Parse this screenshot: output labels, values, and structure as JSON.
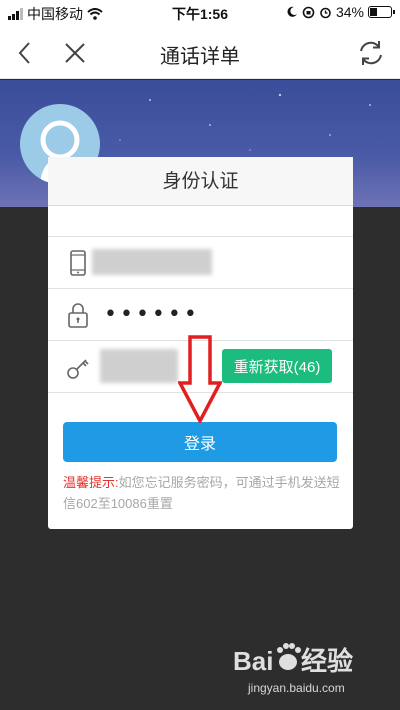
{
  "status_bar": {
    "carrier": "中国移动",
    "time": "下午1:56",
    "battery_percent": "34%",
    "battery_level": 0.34
  },
  "nav": {
    "title": "通话详单"
  },
  "card": {
    "title": "身份认证",
    "password_mask": "••••••",
    "resend_label": "重新获取(46)",
    "login_label": "登录",
    "tip_label": "温馨提示:",
    "tip_text": "如您忘记服务密码，可通过手机发送短信602至10086重置"
  },
  "watermark": {
    "brand": "Baidu经验",
    "url": "jingyan.baidu.com"
  },
  "colors": {
    "header_blue": "#3a4d9a",
    "resend_green": "#1bbc7d",
    "login_blue": "#1e9be4",
    "tip_red": "#e7322f",
    "annotation_red": "#e02020"
  },
  "icons": {
    "back": "chevron-left-icon",
    "close": "close-icon",
    "refresh": "refresh-icon",
    "phone": "phone-icon",
    "lock": "lock-icon",
    "key": "key-icon"
  }
}
